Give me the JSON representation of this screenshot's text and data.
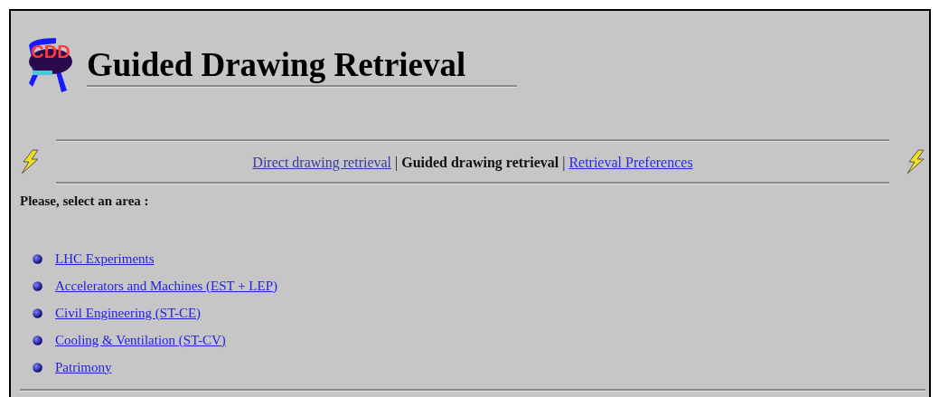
{
  "header": {
    "logo_text": "CDD",
    "title": "Guided Drawing Retrieval"
  },
  "nav": [
    {
      "label": "Direct drawing retrieval",
      "kind": "link",
      "visited": true
    },
    {
      "label": "|",
      "kind": "separator"
    },
    {
      "label": "Guided drawing retrieval",
      "kind": "current"
    },
    {
      "label": "|",
      "kind": "separator"
    },
    {
      "label": "Retrieval Preferences",
      "kind": "link",
      "visited": false
    }
  ],
  "prompt": "Please, select an area :",
  "areas": [
    "LHC Experiments",
    "Accelerators and Machines (EST + LEP)",
    "Civil Engineering (ST-CE)",
    "Cooling & Ventilation (ST-CV)",
    "Patrimony"
  ]
}
